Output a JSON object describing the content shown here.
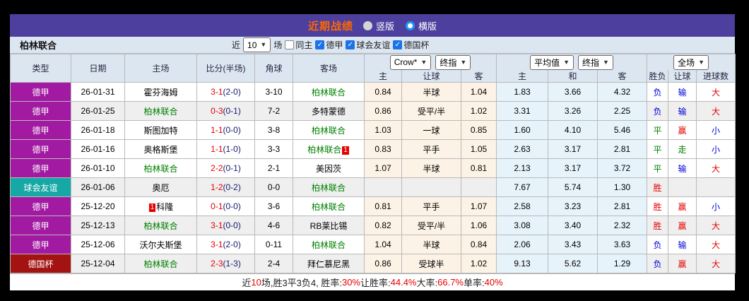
{
  "title_bar": {
    "title": "近期战绩",
    "radios": [
      {
        "label": "竖版",
        "selected": false
      },
      {
        "label": "横版",
        "selected": true
      }
    ]
  },
  "control_bar": {
    "team_name": "柏林联合",
    "recent_label": "近",
    "count_value": "10",
    "matches_label": "场",
    "checkboxes": [
      {
        "label": "同主",
        "checked": false
      },
      {
        "label": "德甲",
        "checked": true
      },
      {
        "label": "球会友谊",
        "checked": true
      },
      {
        "label": "德国杯",
        "checked": true
      }
    ]
  },
  "table": {
    "col_headers": [
      "类型",
      "日期",
      "主场",
      "比分(半场)",
      "角球",
      "客场"
    ],
    "selects": {
      "crow": "Crow*",
      "crow_final": "终指",
      "avg": "平均值",
      "avg_final": "终指",
      "scope": "全场"
    },
    "sub_headers": [
      "主",
      "让球",
      "客",
      "主",
      "和",
      "客",
      "胜负",
      "让球",
      "进球数"
    ],
    "colors": {
      "胜": "#e60000",
      "平": "#008000",
      "负": "#0000d8",
      "赢": "#e60000",
      "走": "#008000",
      "输": "#0000d8",
      "大": "#e60000",
      "小": "#0000d8"
    },
    "rows": [
      {
        "type": "德甲",
        "type_color": "#a219a2",
        "date": "26-01-31",
        "home": "霍芬海姆",
        "home_subject": false,
        "score": "3-1",
        "half": "(2-0)",
        "corner": "3-10",
        "away": "柏林联合",
        "away_subject": true,
        "odds_home": "0.84",
        "handicap": "半球",
        "odds_away": "1.04",
        "avg_home": "1.83",
        "avg_draw": "3.66",
        "avg_away": "4.32",
        "result": "负",
        "handicap_result": "输",
        "goals_result": "大",
        "shaded": false
      },
      {
        "type": "德甲",
        "type_color": "#a219a2",
        "date": "26-01-25",
        "home": "柏林联合",
        "home_subject": true,
        "score": "0-3",
        "half": "(0-1)",
        "corner": "7-2",
        "away": "多特蒙德",
        "away_subject": false,
        "odds_home": "0.86",
        "handicap": "受平/半",
        "odds_away": "1.02",
        "avg_home": "3.31",
        "avg_draw": "3.26",
        "avg_away": "2.25",
        "result": "负",
        "handicap_result": "输",
        "goals_result": "大",
        "shaded": true
      },
      {
        "type": "德甲",
        "type_color": "#a219a2",
        "date": "26-01-18",
        "home": "斯图加特",
        "home_subject": false,
        "score": "1-1",
        "half": "(0-0)",
        "corner": "3-8",
        "away": "柏林联合",
        "away_subject": true,
        "odds_home": "1.03",
        "handicap": "一球",
        "odds_away": "0.85",
        "avg_home": "1.60",
        "avg_draw": "4.10",
        "avg_away": "5.46",
        "result": "平",
        "handicap_result": "赢",
        "goals_result": "小",
        "shaded": false
      },
      {
        "type": "德甲",
        "type_color": "#a219a2",
        "date": "26-01-16",
        "home": "奥格斯堡",
        "home_subject": false,
        "score": "1-1",
        "half": "(1-0)",
        "corner": "3-3",
        "away": "柏林联合",
        "away_subject": true,
        "away_badge": "1",
        "away_badge_pos": "after",
        "odds_home": "0.83",
        "handicap": "平手",
        "odds_away": "1.05",
        "avg_home": "2.63",
        "avg_draw": "3.17",
        "avg_away": "2.81",
        "result": "平",
        "handicap_result": "走",
        "goals_result": "小",
        "shaded": false
      },
      {
        "type": "德甲",
        "type_color": "#a219a2",
        "date": "26-01-10",
        "home": "柏林联合",
        "home_subject": true,
        "score": "2-2",
        "half": "(0-1)",
        "corner": "2-1",
        "away": "美因茨",
        "away_subject": false,
        "odds_home": "1.07",
        "handicap": "半球",
        "odds_away": "0.81",
        "avg_home": "2.13",
        "avg_draw": "3.17",
        "avg_away": "3.72",
        "result": "平",
        "handicap_result": "输",
        "goals_result": "大",
        "shaded": false
      },
      {
        "type": "球会友谊",
        "type_color": "#16a8a4",
        "date": "26-01-06",
        "home": "奥厄",
        "home_subject": false,
        "score": "1-2",
        "half": "(0-2)",
        "corner": "0-0",
        "away": "柏林联合",
        "away_subject": true,
        "odds_home": "",
        "handicap": "",
        "odds_away": "",
        "avg_home": "7.67",
        "avg_draw": "5.74",
        "avg_away": "1.30",
        "result": "胜",
        "handicap_result": "",
        "goals_result": "",
        "shaded": true
      },
      {
        "type": "德甲",
        "type_color": "#a219a2",
        "date": "25-12-20",
        "home": "科隆",
        "home_subject": false,
        "home_badge": "1",
        "home_badge_pos": "before",
        "score": "0-1",
        "half": "(0-0)",
        "corner": "3-6",
        "away": "柏林联合",
        "away_subject": true,
        "odds_home": "0.81",
        "handicap": "平手",
        "odds_away": "1.07",
        "avg_home": "2.58",
        "avg_draw": "3.23",
        "avg_away": "2.81",
        "result": "胜",
        "handicap_result": "赢",
        "goals_result": "小",
        "shaded": false
      },
      {
        "type": "德甲",
        "type_color": "#a219a2",
        "date": "25-12-13",
        "home": "柏林联合",
        "home_subject": true,
        "score": "3-1",
        "half": "(0-0)",
        "corner": "4-6",
        "away": "RB莱比锡",
        "away_subject": false,
        "odds_home": "0.82",
        "handicap": "受平/半",
        "odds_away": "1.06",
        "avg_home": "3.08",
        "avg_draw": "3.40",
        "avg_away": "2.32",
        "result": "胜",
        "handicap_result": "赢",
        "goals_result": "大",
        "shaded": true
      },
      {
        "type": "德甲",
        "type_color": "#a219a2",
        "date": "25-12-06",
        "home": "沃尔夫斯堡",
        "home_subject": false,
        "score": "3-1",
        "half": "(2-0)",
        "corner": "0-11",
        "away": "柏林联合",
        "away_subject": true,
        "odds_home": "1.04",
        "handicap": "半球",
        "odds_away": "0.84",
        "avg_home": "2.06",
        "avg_draw": "3.43",
        "avg_away": "3.63",
        "result": "负",
        "handicap_result": "输",
        "goals_result": "大",
        "shaded": false
      },
      {
        "type": "德国杯",
        "type_color": "#a31312",
        "date": "25-12-04",
        "home": "柏林联合",
        "home_subject": true,
        "score": "2-3",
        "half": "(1-3)",
        "corner": "2-4",
        "away": "拜仁慕尼黑",
        "away_subject": false,
        "odds_home": "0.86",
        "handicap": "受球半",
        "odds_away": "1.02",
        "avg_home": "9.13",
        "avg_draw": "5.62",
        "avg_away": "1.29",
        "result": "负",
        "handicap_result": "赢",
        "goals_result": "大",
        "shaded": true
      }
    ]
  },
  "summary": {
    "segments": [
      {
        "text": "近",
        "red": false
      },
      {
        "text": "10",
        "red": true
      },
      {
        "text": "场,胜3平3负4, 胜率:",
        "red": false
      },
      {
        "text": "30%",
        "red": true
      },
      {
        "text": " 让胜率:",
        "red": false
      },
      {
        "text": "44.4%",
        "red": true
      },
      {
        "text": " 大率:",
        "red": false
      },
      {
        "text": "66.7%",
        "red": true
      },
      {
        "text": " 单率:",
        "red": false
      },
      {
        "text": "40%",
        "red": true
      }
    ]
  }
}
